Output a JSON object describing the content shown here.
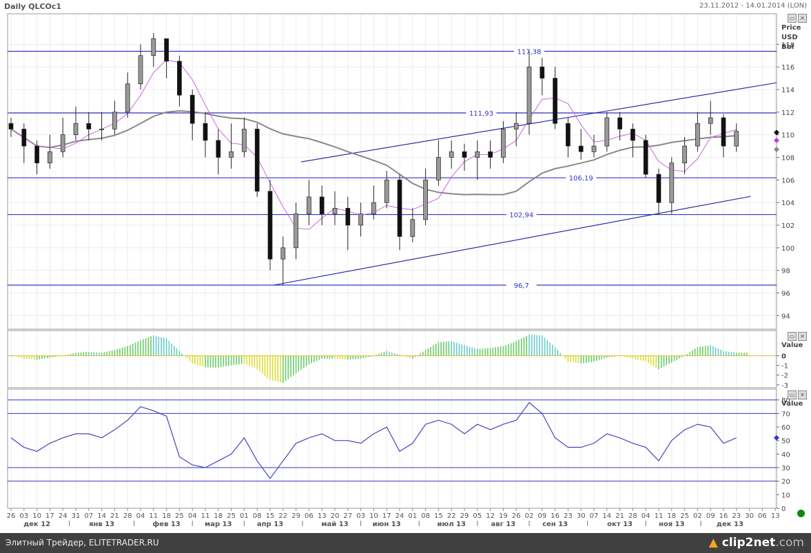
{
  "header": {
    "title": "Daily QLCOc1",
    "range": "23.11.2012 - 14.01.2014 (LON)"
  },
  "price_axis": {
    "label1": "Price",
    "label2": "USD",
    "label3": "Bbl"
  },
  "macd_axis": {
    "label": "Value"
  },
  "rsi_axis": {
    "label": "Value"
  },
  "footer": {
    "left": "Элитный Трейдер, ELITETRADER.RU",
    "brand": "clip2net",
    "brand_domain": ".com"
  },
  "colors": {
    "level": "#3333cc",
    "trend": "#1a1aa0",
    "ma_fast": "#cc66dd",
    "ma_slow": "#888888",
    "rsi": "#4444bb",
    "macd_pos": "#66cc66",
    "macd_neg": "#dddd33",
    "macd_fade": "#66cccc"
  },
  "chart_data": {
    "type": "candlestick",
    "title": "Daily QLCOc1",
    "x_ticks": [
      "26",
      "03",
      "10",
      "17",
      "24",
      "31",
      "07",
      "14",
      "21",
      "28",
      "04",
      "11",
      "18",
      "25",
      "04",
      "11",
      "18",
      "25",
      "01",
      "08",
      "15",
      "22",
      "29",
      "06",
      "13",
      "20",
      "27",
      "03",
      "10",
      "17",
      "24",
      "01",
      "08",
      "15",
      "22",
      "29",
      "05",
      "12",
      "19",
      "26",
      "02",
      "09",
      "16",
      "23",
      "30",
      "07",
      "14",
      "21",
      "28",
      "04",
      "11",
      "18",
      "25",
      "02",
      "09",
      "16",
      "23",
      "30",
      "06",
      "13"
    ],
    "months": [
      {
        "label": "дек 12",
        "tick": 2
      },
      {
        "label": "янв 13",
        "tick": 7
      },
      {
        "label": "фев 13",
        "tick": 12
      },
      {
        "label": "мар 13",
        "tick": 16
      },
      {
        "label": "апр 13",
        "tick": 20
      },
      {
        "label": "май 13",
        "tick": 25
      },
      {
        "label": "июн 13",
        "tick": 29
      },
      {
        "label": "июл 13",
        "tick": 34
      },
      {
        "label": "авг 13",
        "tick": 38
      },
      {
        "label": "сен 13",
        "tick": 42
      },
      {
        "label": "окт 13",
        "tick": 47
      },
      {
        "label": "ноя 13",
        "tick": 51
      },
      {
        "label": "дек 13",
        "tick": 55.5
      }
    ],
    "price": {
      "ylim": [
        92.8,
        120.7
      ],
      "yticks": [
        94,
        96,
        98,
        100,
        102,
        104,
        106,
        108,
        110,
        112,
        114,
        116,
        118
      ],
      "close": [
        110.5,
        109,
        107.5,
        108.5,
        110,
        111,
        110.5,
        110.5,
        112,
        114.5,
        117,
        118.5,
        116.5,
        113.5,
        111,
        109.5,
        108,
        108.5,
        110.5,
        105,
        99,
        100,
        103,
        104.5,
        103,
        103.5,
        102,
        103,
        104,
        106,
        101,
        102.5,
        106,
        108,
        108.5,
        108,
        108.5,
        108,
        110.5,
        111,
        116,
        115,
        111,
        109,
        108.5,
        109,
        111.5,
        110.5,
        109.5,
        106.5,
        104,
        107.5,
        109,
        111,
        111.5,
        109,
        110.3
      ],
      "high": [
        111.5,
        111,
        109.5,
        110,
        111.5,
        112.5,
        112,
        112,
        113,
        115.5,
        118,
        119,
        118.5,
        117,
        114,
        112,
        110.5,
        111,
        111.5,
        111,
        106,
        101,
        104,
        106,
        105.5,
        105,
        104.5,
        104,
        105.5,
        106.8,
        106.5,
        103.5,
        107,
        109.5,
        109.5,
        109.2,
        109.5,
        109.5,
        111.2,
        112,
        117.4,
        116.8,
        116,
        111.5,
        110.5,
        110,
        112,
        112,
        111,
        110,
        107,
        108,
        109.8,
        112,
        113,
        111.8,
        111
      ],
      "low": [
        109.8,
        107.5,
        106.5,
        107,
        108,
        109.5,
        109.5,
        109.5,
        110,
        111.5,
        114,
        116,
        115,
        112.5,
        109.5,
        108,
        106.5,
        107,
        108,
        104.5,
        98,
        96.7,
        99,
        102,
        102,
        102,
        99.8,
        101,
        102.5,
        103.5,
        99.8,
        100.5,
        102,
        105.5,
        107,
        106.8,
        106,
        107,
        107.5,
        109,
        110,
        113.5,
        110.5,
        108,
        107.8,
        108,
        108.5,
        109.5,
        108,
        106.2,
        102.94,
        103,
        106.5,
        108.5,
        110,
        108,
        108.5
      ],
      "levels": [
        {
          "value": 117.38,
          "label": "117,38",
          "label_at": 40
        },
        {
          "value": 111.93,
          "label": "111,93",
          "label_at": 36.3
        },
        {
          "value": 106.19,
          "label": "106,19",
          "label_at": 44
        },
        {
          "value": 102.94,
          "label": "102,94",
          "label_at": 39.4
        },
        {
          "value": 96.7,
          "label": "96,7",
          "label_at": 39.4
        }
      ],
      "trendlines": [
        {
          "from": [
            22.4,
            107.6
          ],
          "to": [
            59.1,
            114.6
          ]
        },
        {
          "from": [
            20.3,
            96.7
          ],
          "to": [
            57.1,
            104.55
          ]
        }
      ],
      "ma_fast_period": 4,
      "ma_slow_period": 20,
      "markers": [
        {
          "value": 110.2,
          "color": "#000000"
        },
        {
          "value": 109.5,
          "color": "#cc33ee"
        },
        {
          "value": 108.7,
          "color": "#888888"
        }
      ]
    },
    "macd": {
      "ylim": [
        -3.3,
        2.6
      ],
      "yticks": [
        0,
        -1,
        -2,
        -3
      ],
      "values": [
        0.1,
        -0.3,
        -0.4,
        -0.2,
        0,
        0.3,
        0.4,
        0.3,
        0.6,
        1,
        1.6,
        2.1,
        1.8,
        0.5,
        -0.8,
        -1.2,
        -1.2,
        -1,
        -0.8,
        -1.4,
        -2.5,
        -2.8,
        -1.8,
        -0.9,
        -0.3,
        -0.3,
        -0.4,
        -0.3,
        0,
        0.5,
        0.1,
        -0.3,
        0.6,
        1.4,
        1.5,
        1.1,
        0.7,
        0.8,
        1,
        1.5,
        2.2,
        2.1,
        0.9,
        -0.6,
        -0.8,
        -0.6,
        -0.2,
        0,
        -0.3,
        -0.6,
        -1.4,
        -0.7,
        0,
        0.9,
        1.1,
        0.5,
        0.3
      ]
    },
    "rsi": {
      "ylim": [
        0,
        88
      ],
      "yticks": [
        80,
        70,
        60,
        50,
        40,
        30,
        20,
        10,
        0
      ],
      "levels": [
        80,
        70,
        30,
        20
      ],
      "current": 52,
      "values": [
        52,
        45,
        42,
        48,
        52,
        55,
        55,
        52,
        58,
        65,
        75,
        72,
        68,
        38,
        32,
        30,
        35,
        40,
        52,
        35,
        22,
        35,
        48,
        52,
        55,
        50,
        50,
        48,
        55,
        60,
        42,
        48,
        62,
        65,
        62,
        55,
        62,
        58,
        62,
        65,
        78,
        70,
        52,
        45,
        45,
        48,
        55,
        52,
        48,
        45,
        35,
        50,
        58,
        62,
        60,
        48,
        52
      ]
    }
  }
}
